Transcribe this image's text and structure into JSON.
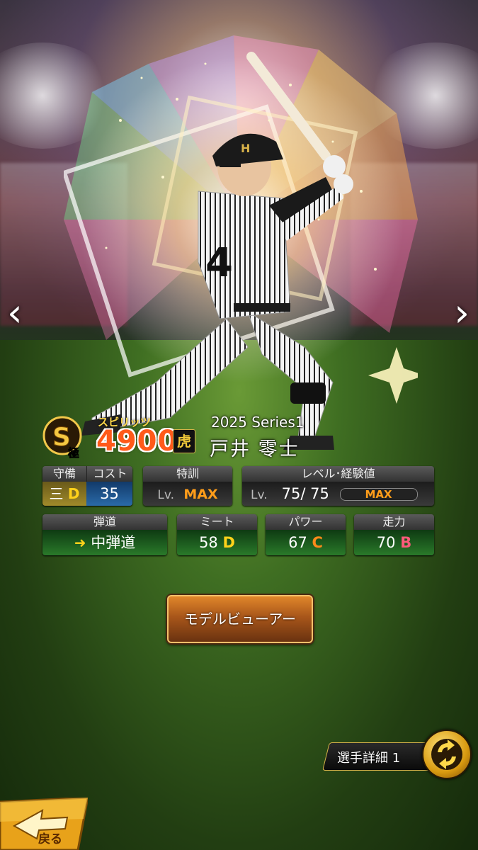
{
  "card": {
    "rank": "極",
    "spirits_label": "スピリッツ",
    "spirits_value": "4900",
    "series": "2025 Series1",
    "player_name": "戸井 零士"
  },
  "stats": {
    "defense": {
      "label": "守備",
      "position": "三",
      "grade": "D"
    },
    "cost": {
      "label": "コスト",
      "value": "35"
    },
    "special_training": {
      "label": "特訓",
      "lv": "Lv.",
      "value": "MAX"
    },
    "level_exp": {
      "label": "レベル･経験値",
      "lv": "Lv.",
      "current": "75/",
      "max_level": "75",
      "exp": "MAX"
    },
    "trajectory": {
      "label": "弾道",
      "value": "中弾道"
    },
    "meet": {
      "label": "ミート",
      "value": "58",
      "grade": "D"
    },
    "power": {
      "label": "パワー",
      "value": "67",
      "grade": "C"
    },
    "speed": {
      "label": "走力",
      "value": "70",
      "grade": "B"
    }
  },
  "buttons": {
    "model_viewer": "モデルビューアー",
    "player_detail": "選手詳細 1",
    "back": "戻る"
  },
  "nav": {
    "prev": "‹",
    "next": "›"
  },
  "icons": {
    "rank_badge": "s-rank-badge-icon",
    "team": "tigers-logo-icon",
    "swap": "swap-arrows-icon",
    "back": "back-arrow-icon",
    "trajectory": "arrow-icon"
  },
  "colors": {
    "spirits": "#ff5a1a",
    "max": "#ff9d1a",
    "grade_d": "#ffd21a",
    "grade_c": "#ff8a1a",
    "grade_b": "#ff5a7a"
  }
}
